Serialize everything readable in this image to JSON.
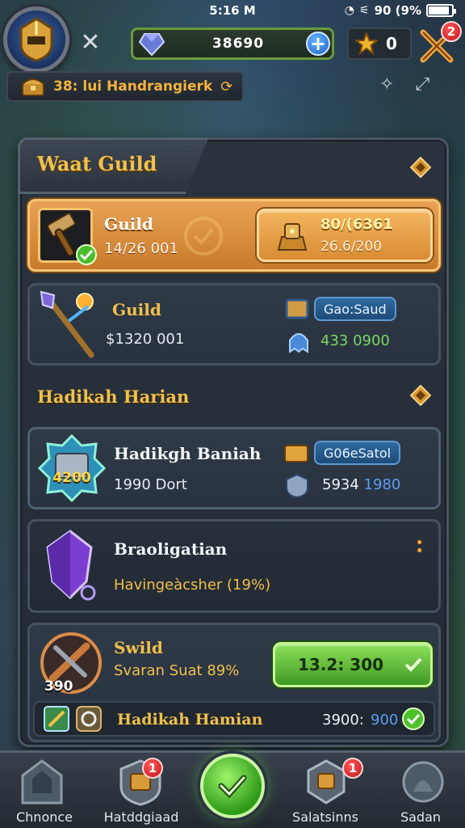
{
  "status_bar": {
    "time": "5:16 M",
    "battery": "90 (9%"
  },
  "hud": {
    "currency_value": "38690",
    "add_label": "+",
    "star_count": "0",
    "swords_badge": "2",
    "subbar_text": "38: lui Handrangierk"
  },
  "panel": {
    "title": "Waat Guild",
    "featured": {
      "title": "Guild",
      "subtitle": "14/26 001",
      "reward_top": "80/(6361",
      "reward_bottom": "26.6/200"
    },
    "card2": {
      "title": "Guild",
      "subtitle": "$1320 001",
      "pill": "Gao:Saud",
      "stat": "433 0900"
    },
    "section_title": "Hadikah Harian",
    "card3": {
      "title": "Hadikgh Baniah",
      "subtitle": "1990 Dort",
      "emblem_value": "4200",
      "pill": "G06eSatol",
      "stat_a": "5934",
      "stat_b": "1980"
    },
    "card4": {
      "title": "Braoligatian",
      "subtitle": "Havingeàcsher (19%)"
    },
    "card5": {
      "title": "Swild",
      "subtitle": "Svaran Suat 89%",
      "emblem_value": "390",
      "claim_label": "13.2: 300",
      "footer_label": "Hadikah Hamian",
      "footer_stat_a": "3900:",
      "footer_stat_b": "900"
    }
  },
  "bottom_nav": {
    "items": [
      {
        "label": "Chnonce",
        "badge": ""
      },
      {
        "label": "Hatddgiaad",
        "badge": "1"
      },
      {
        "label": "",
        "badge": ""
      },
      {
        "label": "Salatsinns",
        "badge": "1"
      },
      {
        "label": "Sadan",
        "badge": ""
      }
    ]
  },
  "colors": {
    "accent_gold": "#f2c04a",
    "panel_bg": "#2a333e",
    "claim_green": "#3f9a24",
    "badge_red": "#c0141a",
    "pill_blue": "#2f6aa0"
  },
  "icons": [
    "helmet-icon",
    "close-icon",
    "gem-icon",
    "plus-icon",
    "star-icon",
    "crossed-swords-icon",
    "treasure-chest-icon",
    "diamond-icon",
    "hammer-icon",
    "checkmark-icon",
    "staff-icon",
    "shield-icon",
    "crystal-icon",
    "home-icon",
    "settings-icon"
  ]
}
